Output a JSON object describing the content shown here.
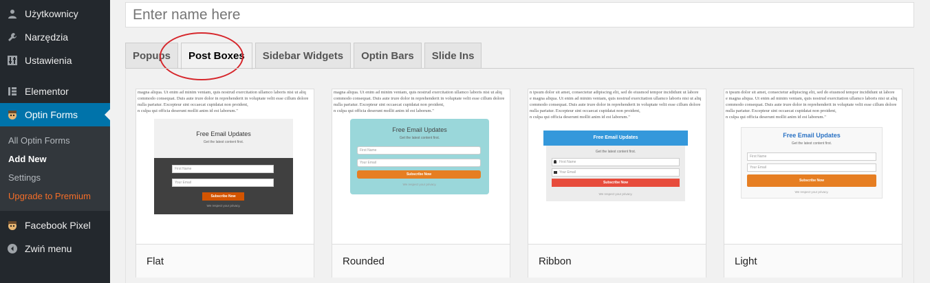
{
  "sidebar": {
    "items": [
      {
        "label": "Użytkownicy",
        "icon": "users-icon"
      },
      {
        "label": "Narzędzia",
        "icon": "wrench-icon"
      },
      {
        "label": "Ustawienia",
        "icon": "settings-icon"
      },
      {
        "label": "Elementor",
        "icon": "elementor-icon"
      },
      {
        "label": "Optin Forms",
        "icon": "optin-forms-icon"
      }
    ],
    "submenu": [
      "All Optin Forms",
      "Add New",
      "Settings",
      "Upgrade to Premium"
    ],
    "after": [
      {
        "label": "Facebook Pixel",
        "icon": "facebook-pixel-icon"
      },
      {
        "label": "Zwiń menu",
        "icon": "collapse-icon"
      }
    ]
  },
  "title_input": {
    "placeholder": "Enter name here"
  },
  "tabs": [
    "Popups",
    "Post Boxes",
    "Sidebar Widgets",
    "Optin Bars",
    "Slide Ins"
  ],
  "lorem_lines": [
    "magna aliqua. Ut enim ad minim veniam, quis nostrud exercitation ullamco laboris nisi ut aliq",
    "commodo consequat. Duis aute irure dolor in reprehenderit in voluptate velit esse cillum dolore",
    " nulla pariatur. Excepteur sint occaecat cupidatat non proident,",
    "n culpa qui officia deserunt mollit anim id est laborum.\""
  ],
  "lorem_lines_b": [
    "n ipsum dolor sit amet, consectetur adipiscing elit, sed do eiusmod tempor incididunt ut labore",
    "e magna aliqua. Ut enim ad minim veniam, quis nostrud exercitation ullamco laboris nisi ut aliq",
    "commodo consequat. Duis aute irure dolor in reprehenderit in voluptate velit esse cillum dolore",
    " nulla pariatur. Excepteur sint occaecat cupidatat non proident,",
    "n culpa qui officia deserunt mollit anim id est laborum.\""
  ],
  "form": {
    "title": "Free Email Updates",
    "subtitle": "Get the latest content first.",
    "first_name": "First Name",
    "email": "Your Email",
    "button": "Subscribe Now",
    "note": "We respect your privacy."
  },
  "cards": [
    {
      "name": "Flat"
    },
    {
      "name": "Rounded"
    },
    {
      "name": "Ribbon"
    },
    {
      "name": "Light"
    }
  ],
  "colors": {
    "sidebar_bg": "#23282d",
    "active_blue": "#0073aa",
    "premium_orange": "#f56e28",
    "flat_dark": "#404040",
    "rounded_teal": "#9ad7da",
    "ribbon_blue": "#3498db",
    "ribbon_red": "#e74c3c",
    "button_orange": "#e67e22",
    "flat_button": "#d35400",
    "highlight_red": "#d6262b"
  }
}
